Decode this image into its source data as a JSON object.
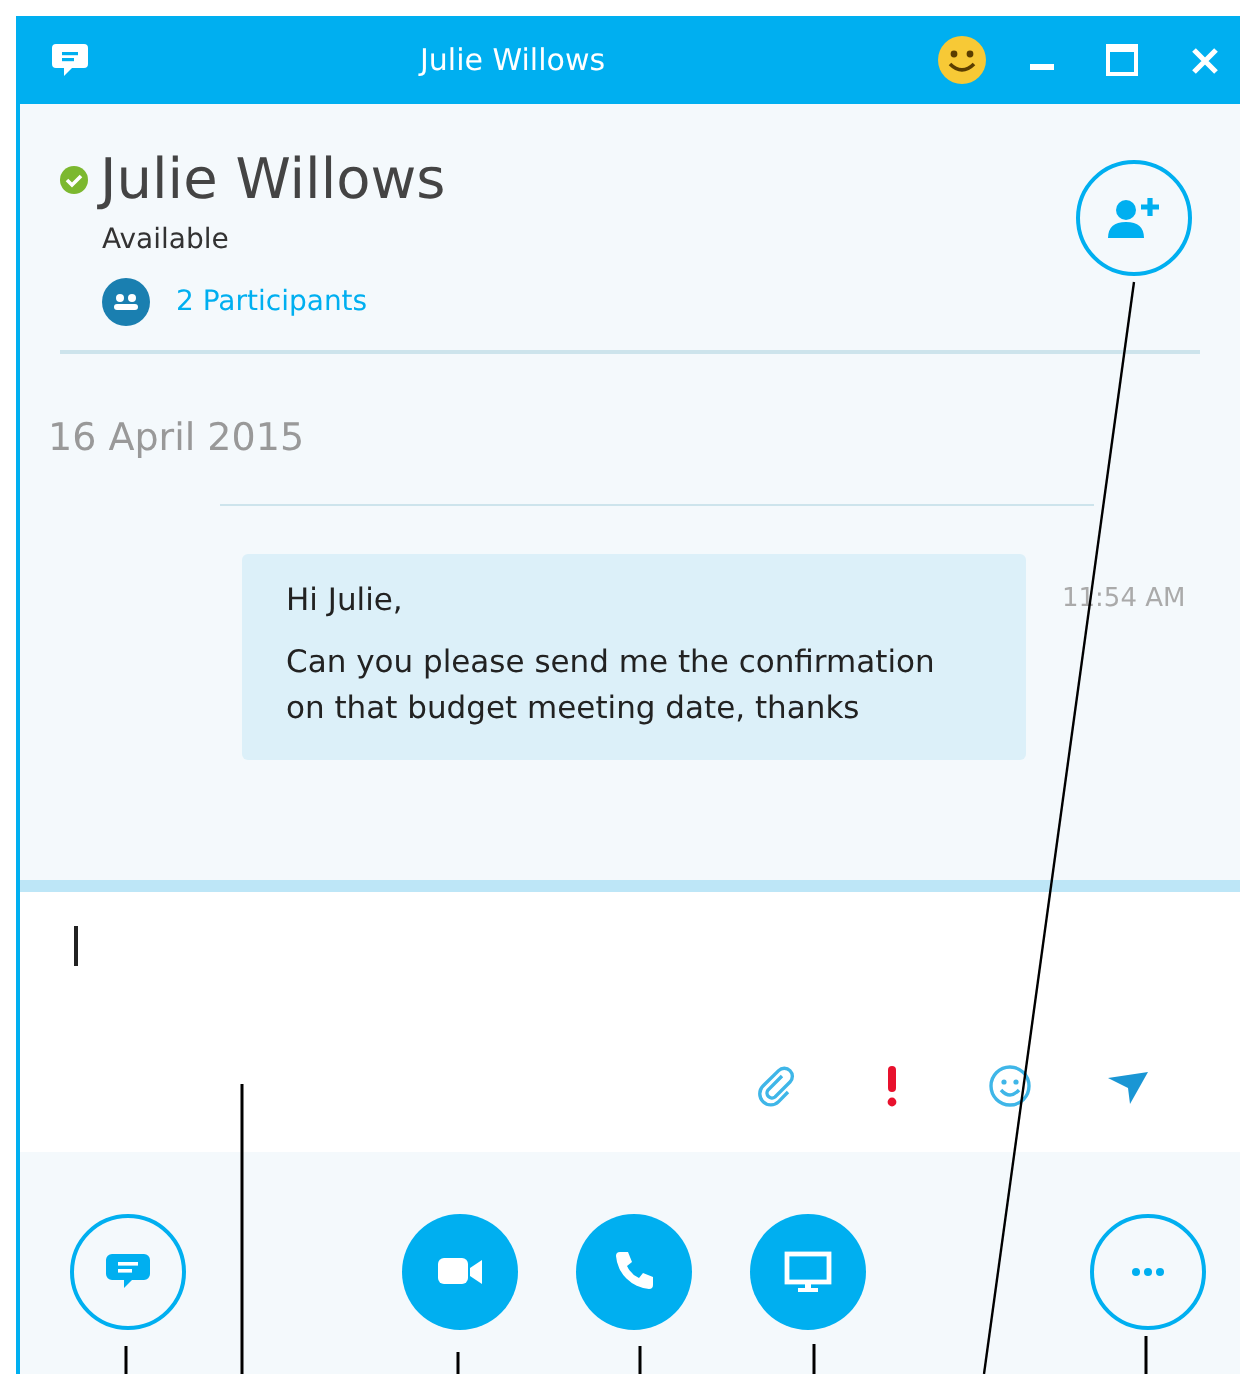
{
  "window": {
    "title": "Julie Willows"
  },
  "contact": {
    "name": "Julie Willows",
    "status": "Available",
    "participants": "2 Participants"
  },
  "conversation": {
    "date": "16 April 2015",
    "messages": [
      {
        "paragraphs": [
          "Hi Julie,",
          "Can you please send me the confirmation on that budget meeting date, thanks"
        ],
        "time": "11:54 AM"
      }
    ]
  },
  "composer_tools": [
    {
      "kind": "attach"
    },
    {
      "kind": "priority"
    },
    {
      "kind": "emoticon"
    },
    {
      "kind": "send"
    }
  ],
  "call_buttons": [
    {
      "kind": "chat"
    },
    {
      "kind": "video"
    },
    {
      "kind": "call"
    },
    {
      "kind": "share"
    },
    {
      "kind": "more"
    }
  ]
}
